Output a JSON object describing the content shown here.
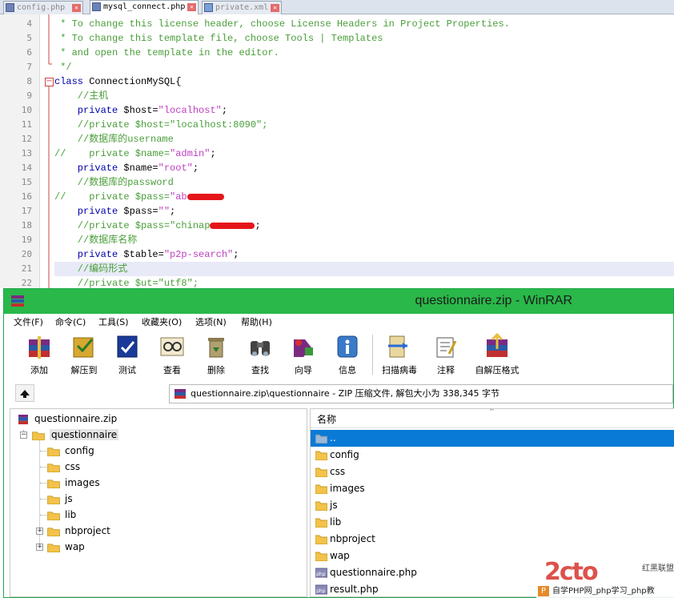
{
  "editor": {
    "tabs": [
      {
        "label": "config.php"
      },
      {
        "label": "mysql_connect.php"
      },
      {
        "label": "private.xml"
      }
    ],
    "line_numbers": [
      "4",
      "5",
      "6",
      "7",
      "8",
      "9",
      "10",
      "11",
      "12",
      "13",
      "14",
      "15",
      "16",
      "17",
      "18",
      "19",
      "20",
      "21",
      "22"
    ],
    "lines": {
      "l4": " * To change this license header, choose License Headers in Project Properties.",
      "l5": " * To change this template file, choose Tools | Templates",
      "l6": " * and open the template in the editor.",
      "l7": " */",
      "l8_kw": "class",
      "l8_rest": " ConnectionMySQL{",
      "l9": "    //主机",
      "l10_kw": "    private",
      "l10_var": " $host=",
      "l10_str": "\"localhost\"",
      "l10_end": ";",
      "l11": "    //private $host=\"localhost:8090\";",
      "l12": "    //数据库的username",
      "l13_cm": "//    private $name=",
      "l13_str": "\"admin\"",
      "l13_end": ";",
      "l14_kw": "    private",
      "l14_var": " $name=",
      "l14_str": "\"root\"",
      "l14_end": ";",
      "l15": "    //数据库的password",
      "l16_cm": "//    private $pass=",
      "l16_str": "\"ab",
      "l17_kw": "    private",
      "l17_var": " $pass=",
      "l17_str": "\"\"",
      "l17_end": ";",
      "l18_cm": "    //private $pass=\"chinap",
      "l18_end": ";",
      "l19": "    //数据库名称",
      "l20_kw": "    private",
      "l20_var": " $table=",
      "l20_str": "\"p2p-search\"",
      "l20_end": ";",
      "l21": "    //编码形式",
      "l22": "    //private $ut=\"utf8\";"
    }
  },
  "winrar": {
    "title": "questionnaire.zip - WinRAR",
    "menu": [
      "文件(F)",
      "命令(C)",
      "工具(S)",
      "收藏夹(O)",
      "选项(N)",
      "帮助(H)"
    ],
    "toolbar": [
      "添加",
      "解压到",
      "测试",
      "查看",
      "删除",
      "查找",
      "向导",
      "信息",
      "扫描病毒",
      "注释",
      "自解压格式"
    ],
    "address": "questionnaire.zip\\questionnaire - ZIP 压缩文件, 解包大小为 338,345 字节",
    "tree": {
      "root": "questionnaire.zip",
      "folder": "questionnaire",
      "children": [
        "config",
        "css",
        "images",
        "js",
        "lib",
        "nbproject",
        "wap"
      ]
    },
    "list": {
      "header": "名称",
      "items": [
        "..",
        "config",
        "css",
        "images",
        "js",
        "lib",
        "nbproject",
        "wap",
        "questionnaire.php",
        "result.php"
      ]
    }
  },
  "watermark": {
    "logo": "2cto",
    "sub": "红黑联盟",
    "line": "自学PHP网_php学习_php教",
    "badge": "P"
  }
}
